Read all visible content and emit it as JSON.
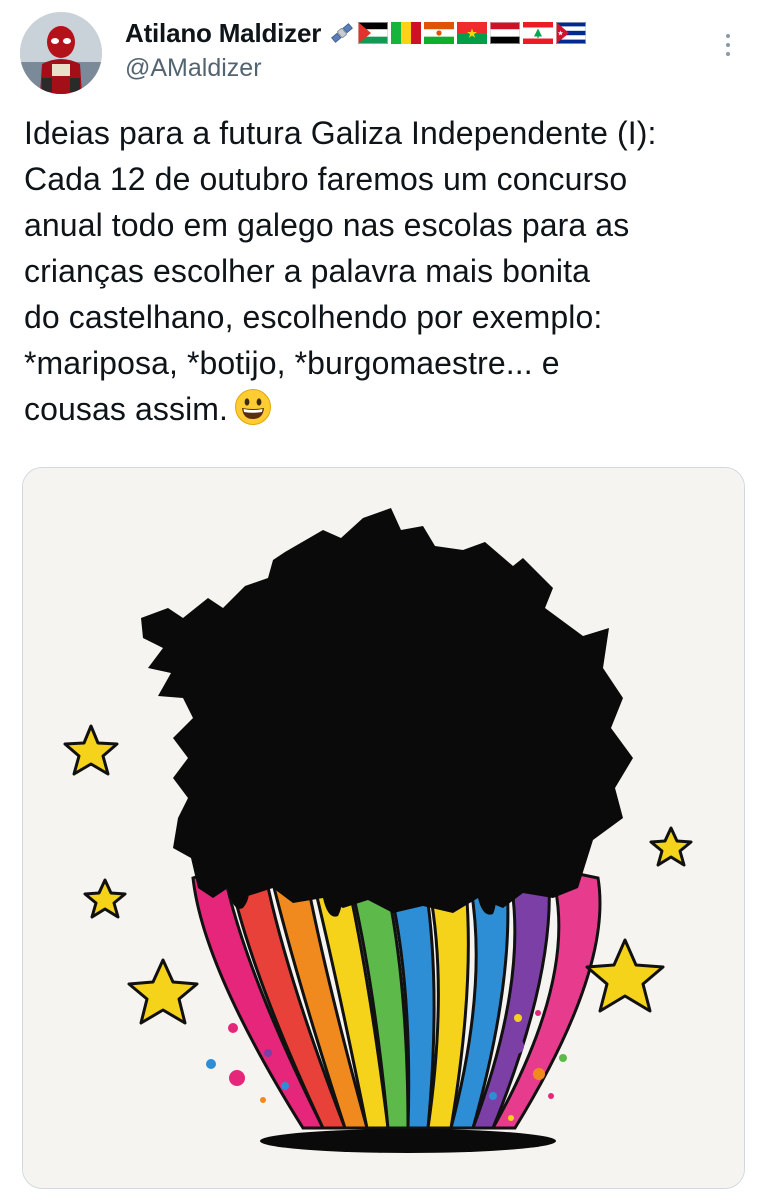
{
  "author": {
    "display_name": "Atilano Maldizer",
    "handle": "@AMaldizer",
    "avatar_icon": "deadpool-avatar-icon",
    "badge_icons": [
      "satellite-icon",
      "palestine-flag-icon",
      "mali-flag-icon",
      "niger-flag-icon",
      "burkina-faso-flag-icon",
      "yemen-flag-icon",
      "lebanon-flag-icon",
      "cuba-flag-icon"
    ]
  },
  "menu": {
    "icon": "more-options-icon"
  },
  "tweet": {
    "lines": [
      "Ideias para a futura Galiza Independente (I):",
      "Cada 12 de outubro faremos um concurso",
      "anual todo em galego nas escolas para as",
      "crianças escolher a palavra mais bonita",
      "do castelhano, escolhendo por exemplo:",
      "*mariposa, *botijo, *burgomaestre... e",
      "cousas assim."
    ],
    "trailing_emoji": "grinning-face-icon"
  },
  "media": {
    "description_icon": "galicia-map-rainbow-illustration",
    "colors": {
      "background": "#f5f4f0",
      "silhouette": "#0a0a0a",
      "rainbow": [
        "#e6267a",
        "#f08a1f",
        "#f6d31b",
        "#5cb94a",
        "#2d8ed6",
        "#7b3fa6",
        "#e73c8e"
      ],
      "star": "#f6d31b"
    }
  }
}
